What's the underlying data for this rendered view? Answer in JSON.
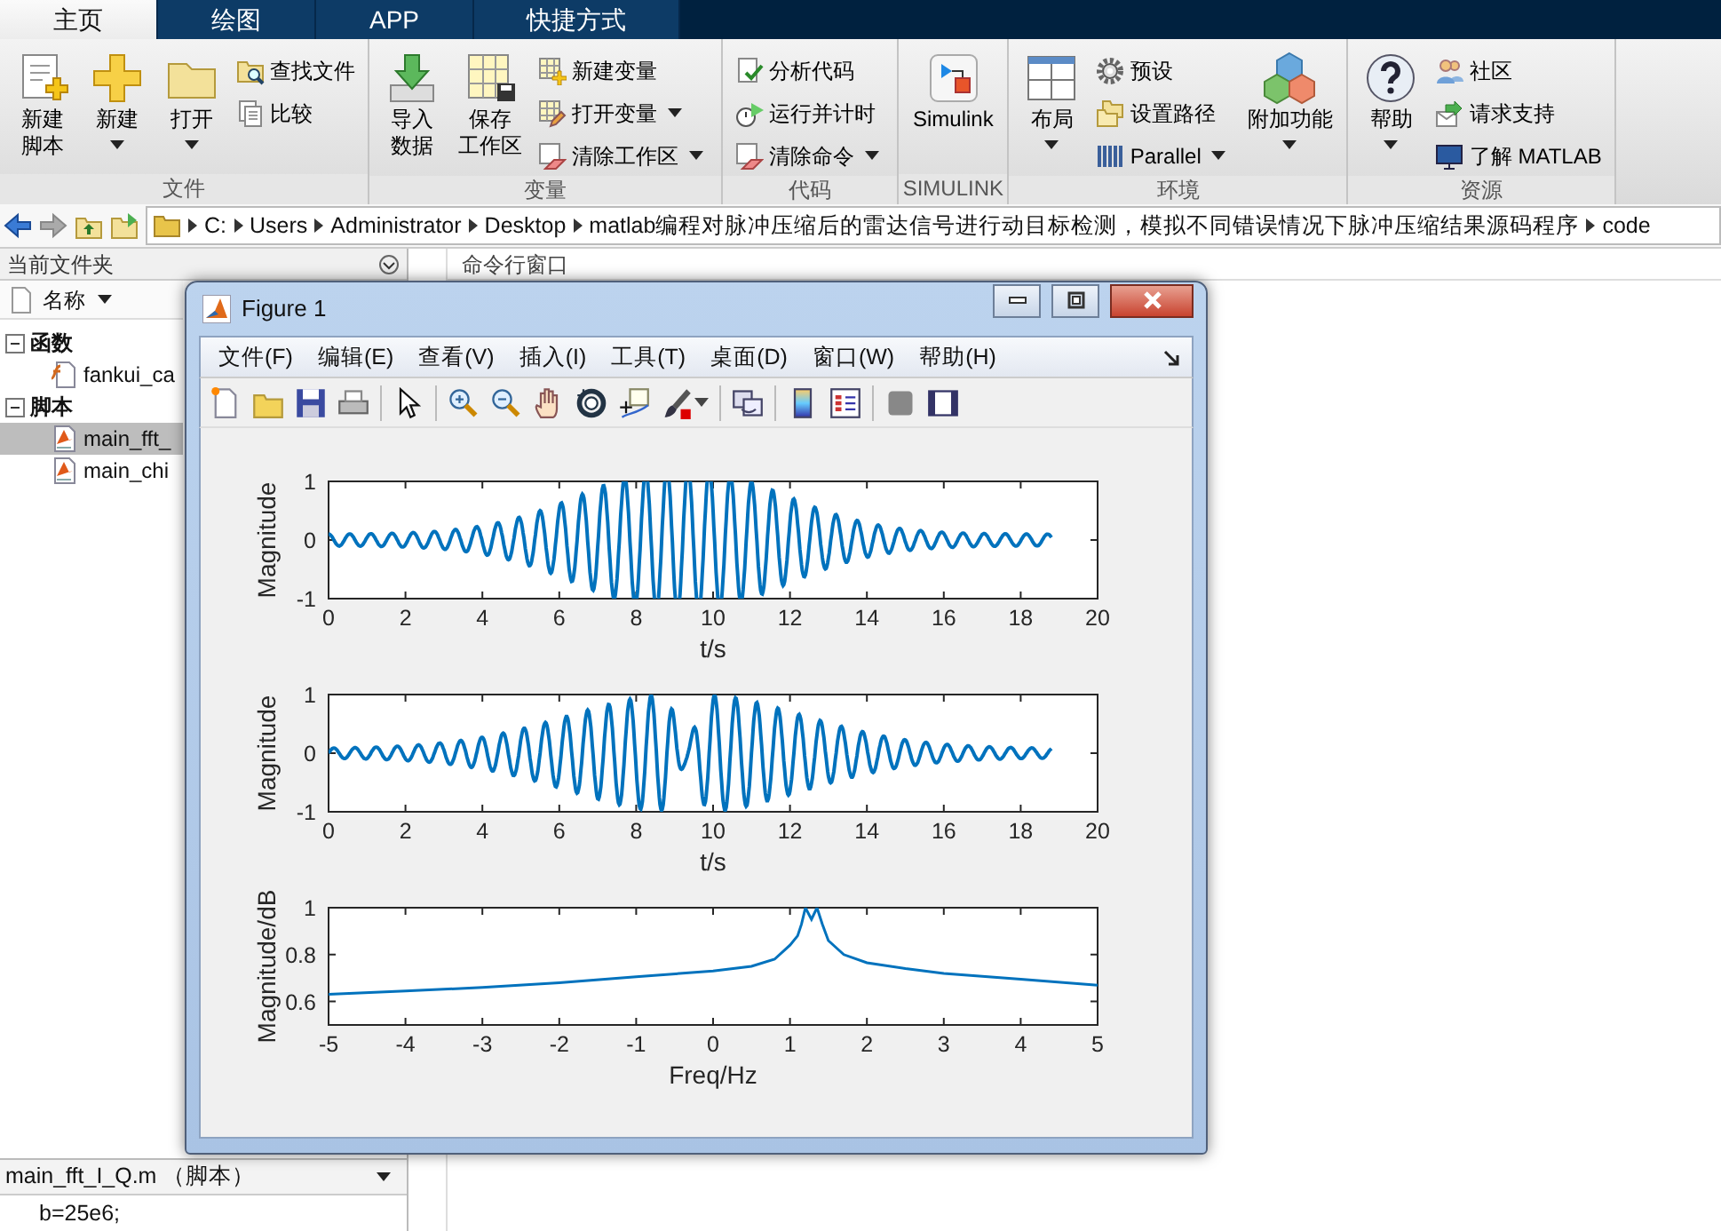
{
  "ribbon_tabs": [
    {
      "label": "主页",
      "selected": true
    },
    {
      "label": "绘图",
      "selected": false
    },
    {
      "label": "APP",
      "selected": false
    },
    {
      "label": "快捷方式",
      "selected": false
    }
  ],
  "ribbon_groups": [
    {
      "label": "文件",
      "items": [
        {
          "kind": "large",
          "lines": [
            "新建",
            "脚本"
          ],
          "dropdown": false
        },
        {
          "kind": "large",
          "lines": [
            "新建"
          ],
          "dropdown": true
        },
        {
          "kind": "large",
          "lines": [
            "打开"
          ],
          "dropdown": true
        },
        {
          "kind": "stack",
          "buttons": [
            {
              "label": "查找文件",
              "dropdown": false
            },
            {
              "label": "比较",
              "dropdown": false
            }
          ]
        }
      ]
    },
    {
      "label": "变量",
      "items": [
        {
          "kind": "large",
          "lines": [
            "导入",
            "数据"
          ],
          "dropdown": false
        },
        {
          "kind": "large",
          "lines": [
            "保存",
            "工作区"
          ],
          "dropdown": false
        },
        {
          "kind": "stack",
          "buttons": [
            {
              "label": "新建变量",
              "dropdown": false
            },
            {
              "label": "打开变量",
              "dropdown": true
            },
            {
              "label": "清除工作区",
              "dropdown": true
            }
          ]
        }
      ]
    },
    {
      "label": "代码",
      "items": [
        {
          "kind": "stack",
          "buttons": [
            {
              "label": "分析代码",
              "dropdown": false
            },
            {
              "label": "运行并计时",
              "dropdown": false
            },
            {
              "label": "清除命令",
              "dropdown": true
            }
          ]
        }
      ]
    },
    {
      "label": "SIMULINK",
      "items": [
        {
          "kind": "large",
          "lines": [
            "Simulink"
          ],
          "dropdown": false
        }
      ]
    },
    {
      "label": "环境",
      "items": [
        {
          "kind": "large",
          "lines": [
            "布局"
          ],
          "dropdown": true
        },
        {
          "kind": "stack",
          "buttons": [
            {
              "label": "预设",
              "dropdown": false
            },
            {
              "label": "设置路径",
              "dropdown": false
            },
            {
              "label": "Parallel",
              "dropdown": true
            }
          ]
        },
        {
          "kind": "large",
          "lines": [
            "附加功能"
          ],
          "dropdown": true
        }
      ]
    },
    {
      "label": "资源",
      "items": [
        {
          "kind": "large",
          "lines": [
            "帮助"
          ],
          "dropdown": true
        },
        {
          "kind": "stack",
          "buttons": [
            {
              "label": "社区",
              "dropdown": false
            },
            {
              "label": "请求支持",
              "dropdown": false
            },
            {
              "label": "了解 MATLAB",
              "dropdown": false
            }
          ]
        }
      ]
    }
  ],
  "address_bar": {
    "path": [
      "C:",
      "Users",
      "Administrator",
      "Desktop",
      "matlab编程对脉冲压缩后的雷达信号进行动目标检测，模拟不同错误情况下脉冲压缩结果源码程序",
      "code"
    ]
  },
  "current_folder": {
    "title": "当前文件夹",
    "column": "名称",
    "tree": [
      {
        "label": "函数",
        "expanded": true,
        "selected": false,
        "children": [
          {
            "label": "fankui_ca",
            "kind": "function",
            "selected": false
          }
        ]
      },
      {
        "label": "脚本",
        "expanded": true,
        "selected": false,
        "children": [
          {
            "label": "main_fft_",
            "kind": "script",
            "selected": true
          },
          {
            "label": "main_chi",
            "kind": "script",
            "selected": false
          }
        ]
      }
    ],
    "details_title": "main_fft_I_Q.m （脚本）",
    "preview_line": "b=25e6;"
  },
  "command_window": {
    "title": "命令行窗口"
  },
  "figure": {
    "title": "Figure 1",
    "menu": [
      "文件(F)",
      "编辑(E)",
      "查看(V)",
      "插入(I)",
      "工具(T)",
      "桌面(D)",
      "窗口(W)",
      "帮助(H)"
    ],
    "axes": [
      {
        "xlabel": "t/s",
        "ylabel": "Magnitude",
        "xticks": [
          "0",
          "2",
          "4",
          "6",
          "8",
          "10",
          "12",
          "14",
          "16",
          "18",
          "20"
        ],
        "yticks": [
          "1",
          "0",
          "-1"
        ]
      },
      {
        "xlabel": "t/s",
        "ylabel": "Magnitude",
        "xticks": [
          "0",
          "2",
          "4",
          "6",
          "8",
          "10",
          "12",
          "14",
          "16",
          "18",
          "20"
        ],
        "yticks": [
          "1",
          "0",
          "-1"
        ]
      }
    ],
    "spectrum": {
      "chart_data": {
        "type": "line",
        "xlabel": "Freq/Hz",
        "ylabel": "Magnitude/dB",
        "xlim": [
          -5,
          5
        ],
        "ylim": [
          0.5,
          1
        ],
        "xticks": [
          -5,
          -4,
          -3,
          -2,
          -1,
          0,
          1,
          2,
          3,
          4,
          5
        ],
        "yticks": [
          1,
          0.8,
          0.6
        ],
        "x": [
          -5,
          -4,
          -3,
          -2,
          -1,
          0,
          0.5,
          0.8,
          1,
          1.1,
          1.15,
          1.2,
          1.28,
          1.35,
          1.42,
          1.5,
          1.7,
          2,
          2.5,
          3,
          4,
          5
        ],
        "series": [
          {
            "color": "#0072bd",
            "values": [
              0.63,
              0.645,
              0.66,
              0.68,
              0.705,
              0.73,
              0.75,
              0.78,
              0.84,
              0.88,
              0.93,
              1,
              0.95,
              1,
              0.93,
              0.86,
              0.8,
              0.765,
              0.74,
              0.72,
              0.695,
              0.67
            ]
          }
        ]
      }
    }
  }
}
